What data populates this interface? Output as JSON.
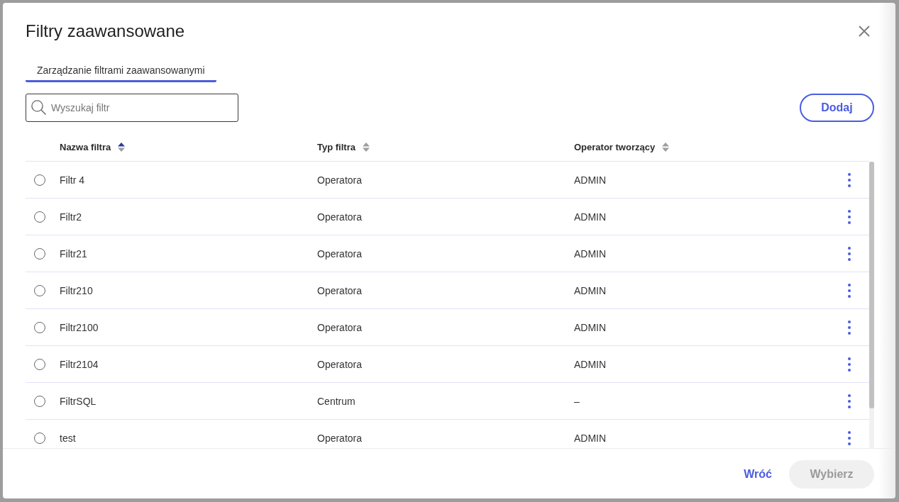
{
  "dialog": {
    "title": "Filtry zaawansowane"
  },
  "tabs": [
    {
      "label": "Zarządzanie filtrami zaawansowanymi",
      "selected": true
    }
  ],
  "search": {
    "placeholder": "Wyszukaj filtr"
  },
  "add_button": "Dodaj",
  "table": {
    "columns": [
      {
        "label": "Nazwa filtra",
        "sorted": true
      },
      {
        "label": "Typ filtra",
        "sorted": false
      },
      {
        "label": "Operator tworzący",
        "sorted": false
      }
    ],
    "rows": [
      {
        "selected": false,
        "cells": [
          "Filtr 4",
          "Operatora",
          "ADMIN"
        ]
      },
      {
        "selected": false,
        "cells": [
          "Filtr2",
          "Operatora",
          "ADMIN"
        ]
      },
      {
        "selected": false,
        "cells": [
          "Filtr21",
          "Operatora",
          "ADMIN"
        ]
      },
      {
        "selected": false,
        "cells": [
          "Filtr210",
          "Operatora",
          "ADMIN"
        ]
      },
      {
        "selected": false,
        "cells": [
          "Filtr2100",
          "Operatora",
          "ADMIN"
        ]
      },
      {
        "selected": false,
        "cells": [
          "Filtr2104",
          "Operatora",
          "ADMIN"
        ]
      },
      {
        "selected": false,
        "cells": [
          "FiltrSQL",
          "Centrum",
          "–"
        ]
      },
      {
        "selected": false,
        "cells": [
          "test",
          "Operatora",
          "ADMIN"
        ]
      }
    ]
  },
  "footer": {
    "buttons": [
      {
        "label": "Wróć",
        "kind": "text",
        "disabled": false
      },
      {
        "label": "Wybierz",
        "kind": "filled",
        "disabled": true
      }
    ]
  }
}
